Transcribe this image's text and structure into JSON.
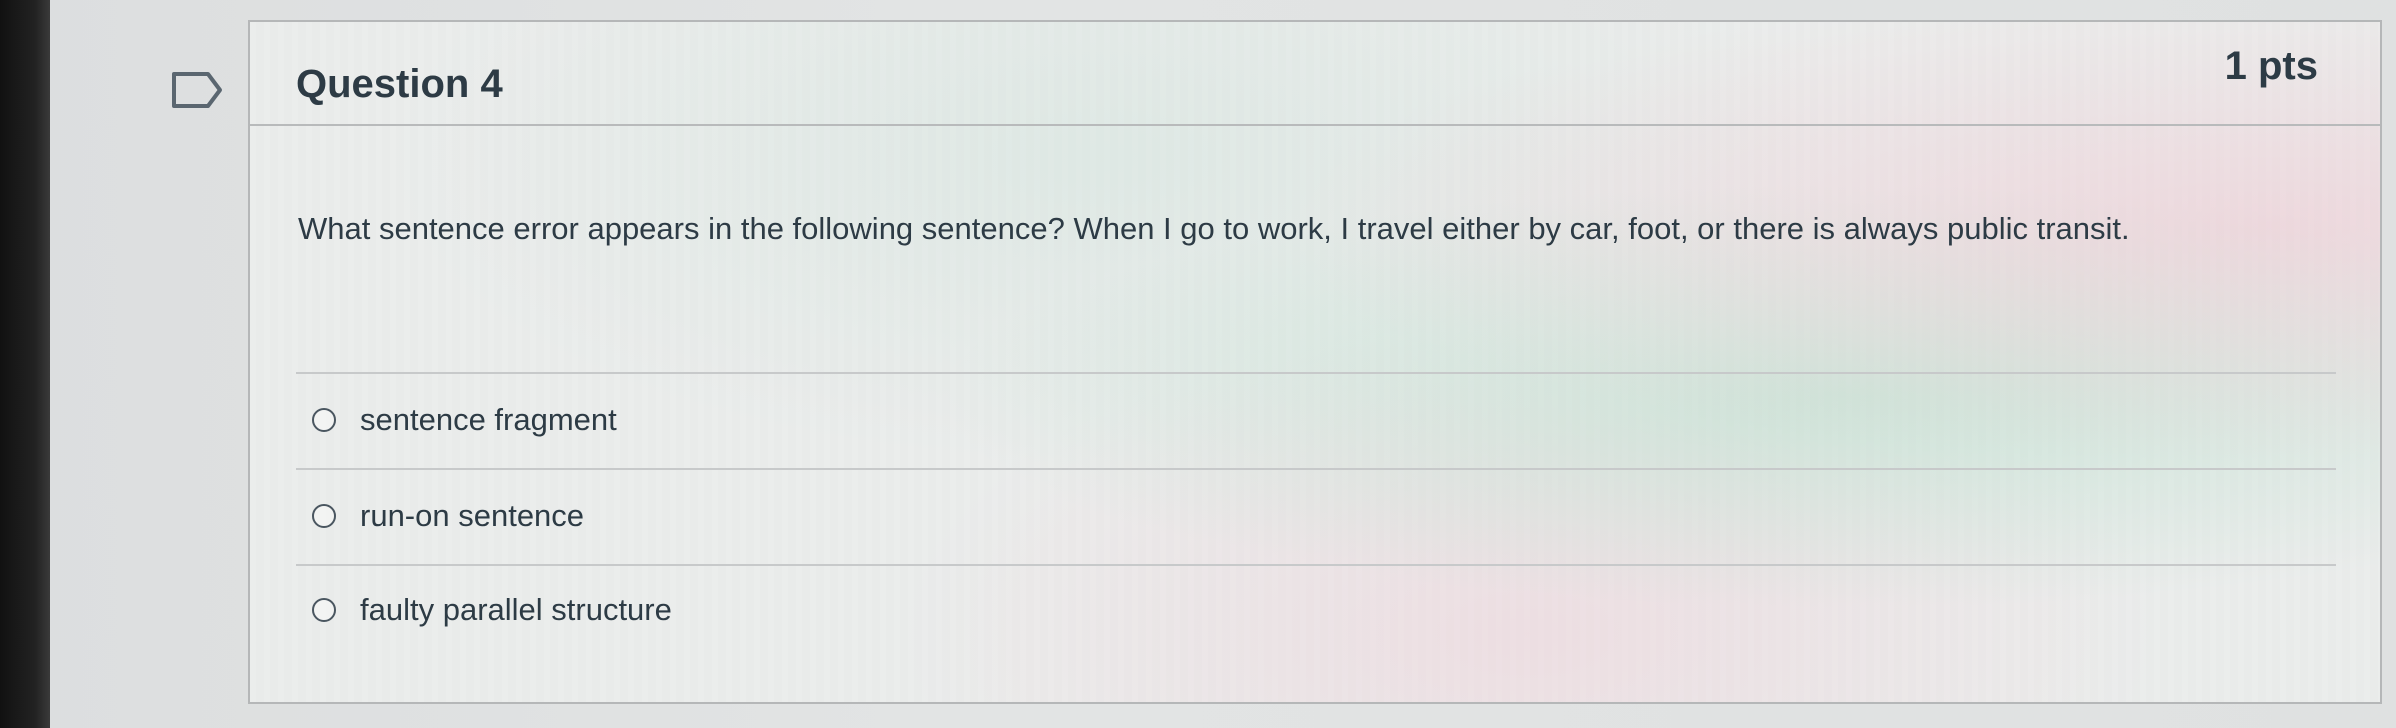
{
  "question": {
    "title": "Question 4",
    "points": "1 pts",
    "text": "What sentence error appears in the following sentence? When I go to work, I travel either by car, foot, or there is always public transit."
  },
  "answers": [
    {
      "label": "sentence fragment",
      "selected": false
    },
    {
      "label": "run-on sentence",
      "selected": false
    },
    {
      "label": "faulty parallel structure",
      "selected": false
    }
  ],
  "icons": {
    "flag": "flag-icon",
    "radio": "radio-icon"
  },
  "colors": {
    "text": "#2d3b45",
    "border": "#b5b7b8"
  }
}
